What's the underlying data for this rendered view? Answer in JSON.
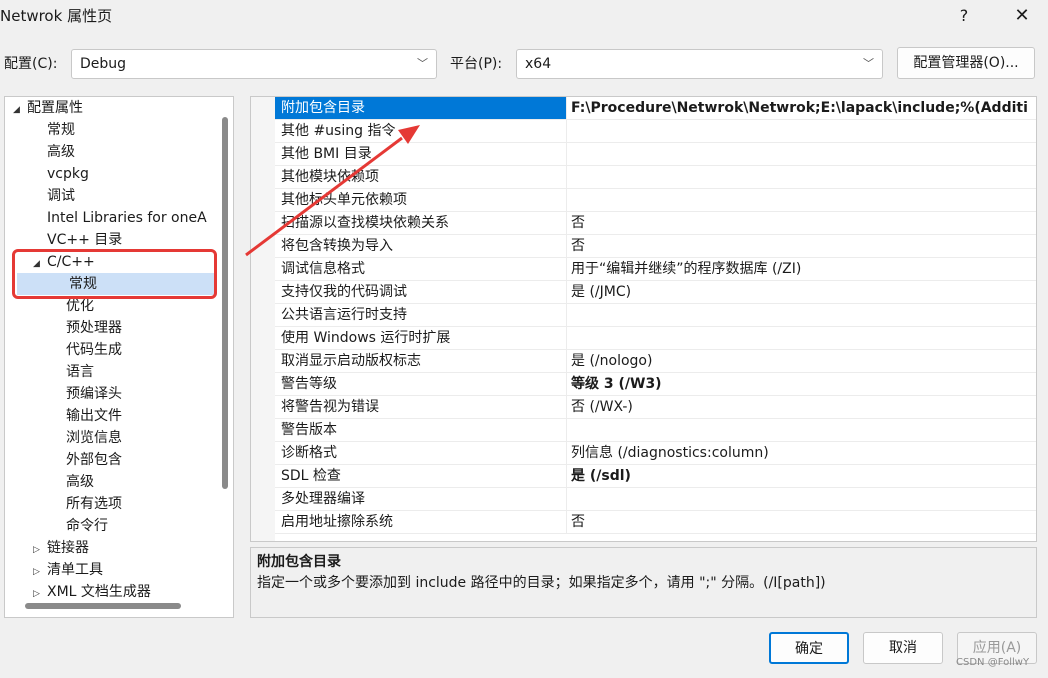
{
  "window": {
    "title": "Netwrok 属性页",
    "help_label": "?",
    "close_label": "✕"
  },
  "config_bar": {
    "config_label": "配置(C):",
    "config_value": "Debug",
    "platform_label": "平台(P):",
    "platform_value": "x64",
    "manager_button": "配置管理器(O)..."
  },
  "tree": {
    "items": [
      {
        "label": "配置属性",
        "level": 0,
        "expander": "◢"
      },
      {
        "label": "常规",
        "level": 1
      },
      {
        "label": "高级",
        "level": 1
      },
      {
        "label": "vcpkg",
        "level": 1
      },
      {
        "label": "调试",
        "level": 1
      },
      {
        "label": "Intel Libraries for oneA",
        "level": 1
      },
      {
        "label": "VC++ 目录",
        "level": 1
      },
      {
        "label": "C/C++",
        "level": 1,
        "expander": "◢"
      },
      {
        "label": "常规",
        "level": 2,
        "selected": true
      },
      {
        "label": "优化",
        "level": 2
      },
      {
        "label": "预处理器",
        "level": 2
      },
      {
        "label": "代码生成",
        "level": 2
      },
      {
        "label": "语言",
        "level": 2
      },
      {
        "label": "预编译头",
        "level": 2
      },
      {
        "label": "输出文件",
        "level": 2
      },
      {
        "label": "浏览信息",
        "level": 2
      },
      {
        "label": "外部包含",
        "level": 2
      },
      {
        "label": "高级",
        "level": 2
      },
      {
        "label": "所有选项",
        "level": 2
      },
      {
        "label": "命令行",
        "level": 2
      },
      {
        "label": "链接器",
        "level": 1,
        "expander": "▷"
      },
      {
        "label": "清单工具",
        "level": 1,
        "expander": "▷"
      },
      {
        "label": "XML 文档生成器",
        "level": 1,
        "expander": "▷"
      }
    ]
  },
  "grid": {
    "rows": [
      {
        "name": "附加包含目录",
        "value": "F:\\Procedure\\Netwrok\\Netwrok;E:\\lapack\\include;%(Additi",
        "bold": true,
        "selected": true
      },
      {
        "name": "其他 #using 指令",
        "value": ""
      },
      {
        "name": "其他 BMI 目录",
        "value": ""
      },
      {
        "name": "其他模块依赖项",
        "value": ""
      },
      {
        "name": "其他标头单元依赖项",
        "value": ""
      },
      {
        "name": "扫描源以查找模块依赖关系",
        "value": "否"
      },
      {
        "name": "将包含转换为导入",
        "value": "否"
      },
      {
        "name": "调试信息格式",
        "value": "用于“编辑并继续”的程序数据库 (/ZI)"
      },
      {
        "name": "支持仅我的代码调试",
        "value": "是 (/JMC)"
      },
      {
        "name": "公共语言运行时支持",
        "value": ""
      },
      {
        "name": "使用 Windows 运行时扩展",
        "value": ""
      },
      {
        "name": "取消显示启动版权标志",
        "value": "是 (/nologo)"
      },
      {
        "name": "警告等级",
        "value": "等级 3 (/W3)",
        "bold": true
      },
      {
        "name": "将警告视为错误",
        "value": "否 (/WX-)"
      },
      {
        "name": "警告版本",
        "value": ""
      },
      {
        "name": "诊断格式",
        "value": "列信息 (/diagnostics:column)"
      },
      {
        "name": "SDL 检查",
        "value": "是 (/sdl)",
        "bold": true
      },
      {
        "name": "多处理器编译",
        "value": ""
      },
      {
        "name": "启用地址擦除系统",
        "value": "否"
      }
    ]
  },
  "description": {
    "title": "附加包含目录",
    "text": "指定一个或多个要添加到 include 路径中的目录；如果指定多个，请用 \";\" 分隔。(/I[path])"
  },
  "buttons": {
    "ok": "确定",
    "cancel": "取消",
    "apply": "应用(A)"
  },
  "watermark": "CSDN @FollwY",
  "colors": {
    "highlight_box": "#e53935",
    "selection": "#0078d7"
  }
}
